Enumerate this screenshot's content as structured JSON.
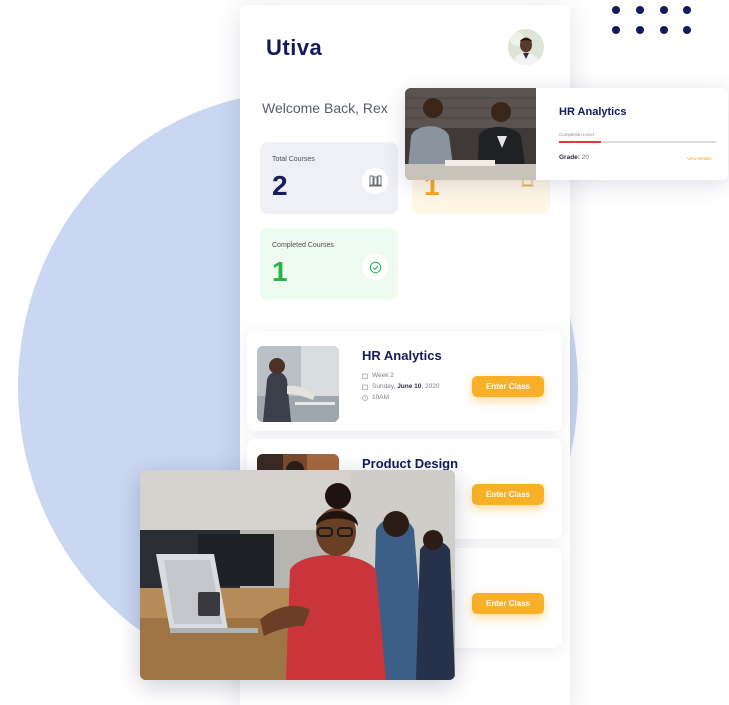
{
  "brand": {
    "logo_text": "Utiva"
  },
  "dashboard": {
    "welcome": "Welcome Back, Rex",
    "stats": [
      {
        "label": "Total Courses",
        "value": "2",
        "icon": "books-icon"
      },
      {
        "label": "",
        "value": "1",
        "icon": "bookmark-icon"
      },
      {
        "label": "Completed Courses",
        "value": "1",
        "icon": "check-circle-icon"
      }
    ]
  },
  "courses": [
    {
      "title": "HR Analytics",
      "week": "Week 2",
      "date_prefix": "Sunday, ",
      "date_bold": "June 10",
      "date_suffix": ", 2020",
      "time": "10AM",
      "button": "Enter Class"
    },
    {
      "title": "Product Design",
      "button": "Enter Class"
    },
    {
      "button": "Enter Class"
    }
  ],
  "float_card": {
    "title": "HR Analytics",
    "completion_label": "Completion Level",
    "completion_fraction": 0.27,
    "grade_label": "Grade:",
    "grade_value": " 20",
    "link": "View Details"
  },
  "colors": {
    "navy": "#151a5a",
    "accent": "#f7b027",
    "green": "#27b348",
    "blob": "#c9d7f3",
    "progress": "#e53a3a"
  }
}
